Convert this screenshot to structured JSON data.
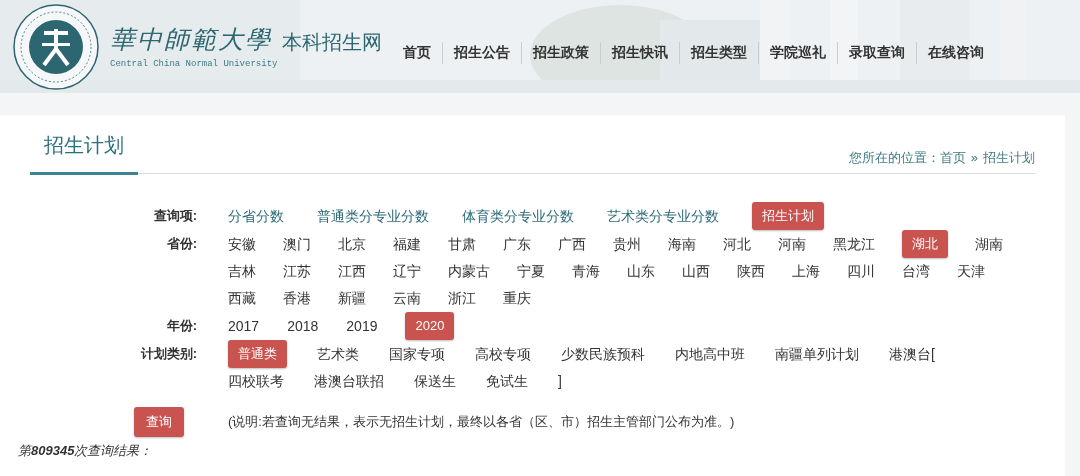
{
  "header": {
    "brand_calligraphy": "華中師範大學",
    "site_name": "本科招生网",
    "english_name": "Central China Normal University",
    "nav": [
      {
        "label": "首页"
      },
      {
        "label": "招生公告"
      },
      {
        "label": "招生政策"
      },
      {
        "label": "招生快讯"
      },
      {
        "label": "招生类型"
      },
      {
        "label": "学院巡礼"
      },
      {
        "label": "录取查询"
      },
      {
        "label": "在线咨询"
      }
    ]
  },
  "page_title": "招生计划",
  "breadcrumb": {
    "prefix": "您所在的位置：",
    "items": [
      "首页",
      "招生计划"
    ],
    "separator": "»"
  },
  "filters": [
    {
      "label": "查询项:",
      "kind": "link",
      "items": [
        {
          "label": "分省分数",
          "selected": false
        },
        {
          "label": "普通类分专业分数",
          "selected": false
        },
        {
          "label": "体育类分专业分数",
          "selected": false
        },
        {
          "label": "艺术类分专业分数",
          "selected": false
        },
        {
          "label": "招生计划",
          "selected": true
        }
      ]
    },
    {
      "label": "省份:",
      "kind": "plain",
      "items": [
        {
          "label": "安徽",
          "selected": false
        },
        {
          "label": "澳门",
          "selected": false
        },
        {
          "label": "北京",
          "selected": false
        },
        {
          "label": "福建",
          "selected": false
        },
        {
          "label": "甘肃",
          "selected": false
        },
        {
          "label": "广东",
          "selected": false
        },
        {
          "label": "广西",
          "selected": false
        },
        {
          "label": "贵州",
          "selected": false
        },
        {
          "label": "海南",
          "selected": false
        },
        {
          "label": "河北",
          "selected": false
        },
        {
          "label": "河南",
          "selected": false
        },
        {
          "label": "黑龙江",
          "selected": false
        },
        {
          "label": "湖北",
          "selected": true
        },
        {
          "label": "湖南",
          "selected": false
        },
        {
          "label": "吉林",
          "selected": false
        },
        {
          "label": "江苏",
          "selected": false
        },
        {
          "label": "江西",
          "selected": false
        },
        {
          "label": "辽宁",
          "selected": false
        },
        {
          "label": "内蒙古",
          "selected": false
        },
        {
          "label": "宁夏",
          "selected": false
        },
        {
          "label": "青海",
          "selected": false
        },
        {
          "label": "山东",
          "selected": false
        },
        {
          "label": "山西",
          "selected": false
        },
        {
          "label": "陕西",
          "selected": false
        },
        {
          "label": "上海",
          "selected": false
        },
        {
          "label": "四川",
          "selected": false
        },
        {
          "label": "台湾",
          "selected": false
        },
        {
          "label": "天津",
          "selected": false
        },
        {
          "label": "西藏",
          "selected": false
        },
        {
          "label": "香港",
          "selected": false
        },
        {
          "label": "新疆",
          "selected": false
        },
        {
          "label": "云南",
          "selected": false
        },
        {
          "label": "浙江",
          "selected": false
        },
        {
          "label": "重庆",
          "selected": false
        }
      ]
    },
    {
      "label": "年份:",
      "kind": "plain",
      "items": [
        {
          "label": "2017",
          "selected": false
        },
        {
          "label": "2018",
          "selected": false
        },
        {
          "label": "2019",
          "selected": false
        },
        {
          "label": "2020",
          "selected": true
        }
      ]
    },
    {
      "label": "计划类别:",
      "kind": "plain",
      "items": [
        {
          "label": "普通类",
          "selected": true
        },
        {
          "label": "艺术类",
          "selected": false
        },
        {
          "label": "国家专项",
          "selected": false
        },
        {
          "label": "高校专项",
          "selected": false
        },
        {
          "label": "少数民族预科",
          "selected": false
        },
        {
          "label": "内地高中班",
          "selected": false
        },
        {
          "label": "南疆单列计划",
          "selected": false
        },
        {
          "label": "港澳台[",
          "selected": false
        },
        {
          "label": "四校联考",
          "selected": false
        },
        {
          "label": "港澳台联招",
          "selected": false
        },
        {
          "label": "保送生",
          "selected": false
        },
        {
          "label": "免试生",
          "selected": false
        },
        {
          "label": "]",
          "selected": false
        }
      ]
    }
  ],
  "query_button": "查询",
  "note": "(说明:若查询无结果，表示无招生计划，最终以各省（区、市）招生主管部门公布为准。)",
  "result_count": "第**809345**次查询结果："
}
